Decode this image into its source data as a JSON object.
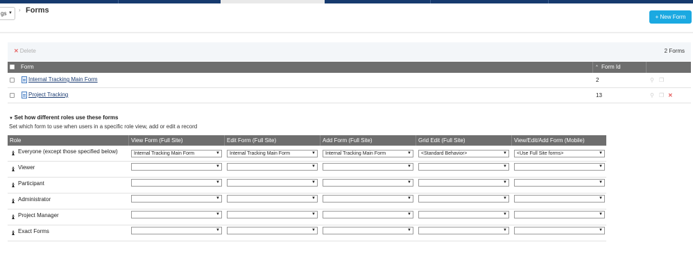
{
  "header": {
    "context_select": "gs",
    "title": "Forms",
    "new_button": "+ New Form"
  },
  "toolbar": {
    "delete_label": "Delete",
    "count": "2 Forms"
  },
  "forms_table": {
    "columns": [
      "Form",
      "Form Id"
    ],
    "sort_indicator": "^",
    "rows": [
      {
        "name": "Internal Tracking Main Form",
        "id": "2"
      },
      {
        "name": "Project Tracking",
        "id": "13"
      }
    ]
  },
  "roles": {
    "heading": "Set how different roles use these forms",
    "subtext": "Set which form to use when users in a specific role view, add or edit a record",
    "columns": [
      "Role",
      "View Form (Full Site)",
      "Edit Form (Full Site)",
      "Add Form (Full Site)",
      "Grid Edit (Full Site)",
      "View/Edit/Add Form (Mobile)"
    ],
    "rows": [
      {
        "role": "Everyone (except those specified below)",
        "values": [
          "Internal Tracking Main Form",
          "Internal Tracking Main Form",
          "Internal Tracking Main Form",
          "<Standard Behavior>",
          "<Use Full Site forms>"
        ]
      },
      {
        "role": "Viewer",
        "values": [
          "",
          "",
          "",
          "",
          ""
        ]
      },
      {
        "role": "Participant",
        "values": [
          "",
          "",
          "",
          "",
          ""
        ]
      },
      {
        "role": "Administrator",
        "values": [
          "",
          "",
          "",
          "",
          ""
        ]
      },
      {
        "role": "Project Manager",
        "values": [
          "",
          "",
          "",
          "",
          ""
        ]
      },
      {
        "role": "Exact Forms",
        "values": [
          "",
          "",
          "",
          "",
          ""
        ]
      }
    ]
  },
  "icons": {
    "delete": "close-icon",
    "document": "document-icon",
    "role": "chess-piece-icon",
    "row_actions": [
      "view-icon",
      "copy-icon",
      "delete-icon"
    ]
  },
  "colors": {
    "top_nav": "#163a6e",
    "primary_button": "#1ba9e1",
    "table_header": "#6e6e6e",
    "link": "#1d3d73",
    "delete_red": "#e55b5b"
  }
}
